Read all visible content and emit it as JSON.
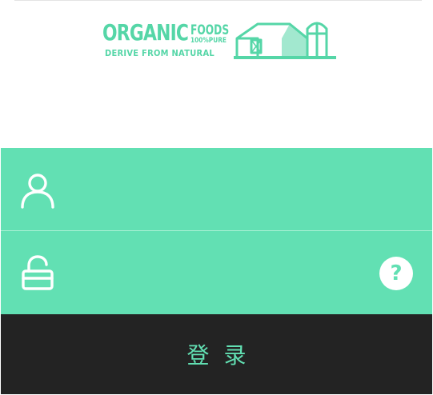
{
  "logo": {
    "brand_main": "ORGANIC",
    "brand_foods": "FOODS",
    "brand_pure": "100%PURE",
    "tagline": "DERIVE FROM NATURAL",
    "icon": "barn-silo-logo"
  },
  "form": {
    "username": {
      "icon": "user-icon",
      "value": "",
      "placeholder": ""
    },
    "password": {
      "icon": "unlock-icon",
      "value": "",
      "placeholder": ""
    },
    "help": {
      "label": "?",
      "icon": "help-icon"
    }
  },
  "login": {
    "label": "登录"
  },
  "colors": {
    "accent": "#62e0b3",
    "logo": "#55d6a7",
    "button_bg": "#232323",
    "background": "#ffffff"
  }
}
